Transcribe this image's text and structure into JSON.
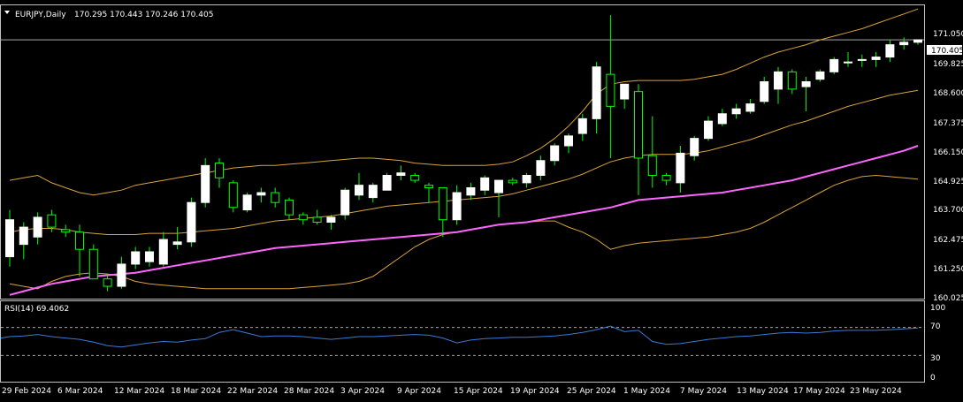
{
  "header": {
    "symbol": "EURJPY,Daily",
    "ohlc": "170.295 170.443 170.246 170.405"
  },
  "rsi_panel": {
    "label": "RSI(14) 69.4062",
    "levels": [
      "100",
      "70",
      "30",
      "0"
    ]
  },
  "price_axis": {
    "ticks": [
      "171.050",
      "169.825",
      "168.600",
      "167.375",
      "166.150",
      "164.925",
      "163.700",
      "162.475",
      "161.250",
      "160.025"
    ],
    "current_price": "170.405"
  },
  "time_axis": {
    "labels": [
      "29 Feb 2024",
      "6 Mar 2024",
      "12 Mar 2024",
      "18 Mar 2024",
      "22 Mar 2024",
      "28 Mar 2024",
      "3 Apr 2024",
      "9 Apr 2024",
      "15 Apr 2024",
      "19 Apr 2024",
      "25 Apr 2024",
      "1 May 2024",
      "7 May 2024",
      "13 May 2024",
      "17 May 2024",
      "23 May 2024"
    ]
  },
  "colors": {
    "background": "#000000",
    "bull_candle": "#ffffff",
    "bear_candle": "#000000",
    "wick": "#00ff00",
    "bollinger": "#d9a33a",
    "ma": "#ff66ff",
    "rsi_line": "#3a7bd5",
    "grid_level": "#c0c0c0",
    "axis": "#c0c0c0"
  },
  "chart_data": [
    {
      "type": "candlestick",
      "title": "EURJPY,Daily",
      "ylim": [
        159.9,
        171.8
      ],
      "indicators": [
        "Bollinger Bands",
        "Moving Average"
      ],
      "candles": [
        {
          "o": 161.6,
          "h": 163.5,
          "l": 161.2,
          "c": 163.1
        },
        {
          "o": 162.1,
          "h": 163.0,
          "l": 161.5,
          "c": 162.8
        },
        {
          "o": 162.4,
          "h": 163.4,
          "l": 162.1,
          "c": 163.2
        },
        {
          "o": 163.3,
          "h": 163.5,
          "l": 162.6,
          "c": 162.8
        },
        {
          "o": 162.7,
          "h": 162.9,
          "l": 162.4,
          "c": 162.6
        },
        {
          "o": 162.6,
          "h": 162.9,
          "l": 160.8,
          "c": 161.9
        },
        {
          "o": 161.9,
          "h": 162.1,
          "l": 160.7,
          "c": 160.7
        },
        {
          "o": 160.7,
          "h": 160.9,
          "l": 160.2,
          "c": 160.4
        },
        {
          "o": 160.4,
          "h": 161.6,
          "l": 160.3,
          "c": 161.3
        },
        {
          "o": 161.3,
          "h": 162.0,
          "l": 161.1,
          "c": 161.8
        },
        {
          "o": 161.4,
          "h": 162.0,
          "l": 161.2,
          "c": 161.8
        },
        {
          "o": 161.3,
          "h": 162.6,
          "l": 161.2,
          "c": 162.3
        },
        {
          "o": 162.1,
          "h": 162.8,
          "l": 161.9,
          "c": 162.2
        },
        {
          "o": 162.2,
          "h": 164.0,
          "l": 162.0,
          "c": 163.8
        },
        {
          "o": 163.8,
          "h": 165.6,
          "l": 163.6,
          "c": 165.3
        },
        {
          "o": 165.4,
          "h": 165.6,
          "l": 164.4,
          "c": 164.8
        },
        {
          "o": 164.6,
          "h": 164.7,
          "l": 163.4,
          "c": 163.6
        },
        {
          "o": 163.5,
          "h": 164.2,
          "l": 163.4,
          "c": 164.1
        },
        {
          "o": 164.1,
          "h": 164.4,
          "l": 163.8,
          "c": 164.2
        },
        {
          "o": 164.2,
          "h": 164.4,
          "l": 163.6,
          "c": 163.8
        },
        {
          "o": 163.9,
          "h": 164.0,
          "l": 163.1,
          "c": 163.3
        },
        {
          "o": 163.3,
          "h": 163.4,
          "l": 162.9,
          "c": 163.1
        },
        {
          "o": 163.2,
          "h": 163.5,
          "l": 162.9,
          "c": 163.0
        },
        {
          "o": 163.0,
          "h": 163.3,
          "l": 162.7,
          "c": 163.2
        },
        {
          "o": 163.3,
          "h": 164.4,
          "l": 163.1,
          "c": 164.3
        },
        {
          "o": 164.1,
          "h": 165.0,
          "l": 163.9,
          "c": 164.5
        },
        {
          "o": 164.0,
          "h": 164.6,
          "l": 163.8,
          "c": 164.5
        },
        {
          "o": 164.3,
          "h": 165.0,
          "l": 164.3,
          "c": 164.9
        },
        {
          "o": 164.9,
          "h": 165.3,
          "l": 164.7,
          "c": 165.0
        },
        {
          "o": 164.9,
          "h": 165.0,
          "l": 164.6,
          "c": 164.7
        },
        {
          "o": 164.5,
          "h": 164.6,
          "l": 163.8,
          "c": 164.4
        },
        {
          "o": 164.4,
          "h": 164.4,
          "l": 162.4,
          "c": 163.1
        },
        {
          "o": 163.1,
          "h": 164.5,
          "l": 162.9,
          "c": 164.2
        },
        {
          "o": 164.1,
          "h": 164.6,
          "l": 163.9,
          "c": 164.4
        },
        {
          "o": 164.3,
          "h": 164.9,
          "l": 164.1,
          "c": 164.8
        },
        {
          "o": 164.2,
          "h": 164.7,
          "l": 163.2,
          "c": 164.7
        },
        {
          "o": 164.7,
          "h": 164.8,
          "l": 164.5,
          "c": 164.6
        },
        {
          "o": 164.6,
          "h": 165.0,
          "l": 164.4,
          "c": 164.9
        },
        {
          "o": 164.9,
          "h": 165.7,
          "l": 164.7,
          "c": 165.5
        },
        {
          "o": 165.5,
          "h": 166.2,
          "l": 165.3,
          "c": 166.1
        },
        {
          "o": 166.1,
          "h": 166.6,
          "l": 165.8,
          "c": 166.5
        },
        {
          "o": 166.6,
          "h": 167.4,
          "l": 166.3,
          "c": 167.2
        },
        {
          "o": 167.2,
          "h": 169.5,
          "l": 166.6,
          "c": 169.3
        },
        {
          "o": 169.0,
          "h": 171.4,
          "l": 165.6,
          "c": 167.7
        },
        {
          "o": 168.0,
          "h": 168.6,
          "l": 167.6,
          "c": 168.6
        },
        {
          "o": 168.3,
          "h": 168.6,
          "l": 164.1,
          "c": 165.6
        },
        {
          "o": 165.7,
          "h": 167.3,
          "l": 164.4,
          "c": 164.9
        },
        {
          "o": 164.9,
          "h": 165.0,
          "l": 164.5,
          "c": 164.7
        },
        {
          "o": 164.6,
          "h": 166.1,
          "l": 164.2,
          "c": 165.8
        },
        {
          "o": 165.7,
          "h": 166.5,
          "l": 165.5,
          "c": 166.4
        },
        {
          "o": 166.4,
          "h": 167.3,
          "l": 166.3,
          "c": 167.1
        },
        {
          "o": 167.0,
          "h": 167.6,
          "l": 166.9,
          "c": 167.4
        },
        {
          "o": 167.4,
          "h": 167.8,
          "l": 167.2,
          "c": 167.6
        },
        {
          "o": 167.5,
          "h": 168.0,
          "l": 167.4,
          "c": 167.8
        },
        {
          "o": 167.9,
          "h": 168.9,
          "l": 167.8,
          "c": 168.7
        },
        {
          "o": 168.4,
          "h": 169.3,
          "l": 167.8,
          "c": 169.1
        },
        {
          "o": 169.1,
          "h": 169.2,
          "l": 168.2,
          "c": 168.4
        },
        {
          "o": 168.5,
          "h": 168.9,
          "l": 167.5,
          "c": 168.7
        },
        {
          "o": 168.8,
          "h": 169.2,
          "l": 168.7,
          "c": 169.1
        },
        {
          "o": 169.1,
          "h": 169.7,
          "l": 169.0,
          "c": 169.6
        },
        {
          "o": 169.5,
          "h": 169.9,
          "l": 169.3,
          "c": 169.5
        },
        {
          "o": 169.6,
          "h": 169.8,
          "l": 169.3,
          "c": 169.6
        },
        {
          "o": 169.6,
          "h": 169.9,
          "l": 169.3,
          "c": 169.7
        },
        {
          "o": 169.7,
          "h": 170.4,
          "l": 169.5,
          "c": 170.2
        },
        {
          "o": 170.2,
          "h": 170.5,
          "l": 170.0,
          "c": 170.3
        },
        {
          "o": 170.3,
          "h": 170.4,
          "l": 170.2,
          "c": 170.4
        }
      ],
      "bb_upper": [
        164.7,
        164.8,
        164.9,
        164.6,
        164.4,
        164.2,
        164.1,
        164.2,
        164.3,
        164.5,
        164.6,
        164.7,
        164.8,
        164.9,
        165.0,
        165.1,
        165.2,
        165.25,
        165.3,
        165.3,
        165.35,
        165.4,
        165.45,
        165.5,
        165.55,
        165.6,
        165.6,
        165.55,
        165.5,
        165.4,
        165.35,
        165.3,
        165.3,
        165.3,
        165.3,
        165.35,
        165.45,
        165.7,
        166.0,
        166.4,
        166.9,
        167.5,
        168.2,
        168.6,
        168.7,
        168.75,
        168.75,
        168.75,
        168.75,
        168.8,
        168.9,
        169.0,
        169.2,
        169.45,
        169.7,
        169.9,
        170.05,
        170.2,
        170.4,
        170.55,
        170.7,
        170.85,
        171.05,
        171.25,
        171.45,
        171.65
      ],
      "bb_middle": [
        162.6,
        162.7,
        162.75,
        162.75,
        162.7,
        162.6,
        162.55,
        162.5,
        162.5,
        162.5,
        162.55,
        162.55,
        162.55,
        162.6,
        162.65,
        162.7,
        162.75,
        162.85,
        162.95,
        163.05,
        163.1,
        163.15,
        163.2,
        163.25,
        163.35,
        163.45,
        163.55,
        163.65,
        163.7,
        163.75,
        163.8,
        163.85,
        163.9,
        163.95,
        164.0,
        164.05,
        164.15,
        164.3,
        164.45,
        164.6,
        164.75,
        164.95,
        165.2,
        165.45,
        165.6,
        165.7,
        165.75,
        165.75,
        165.75,
        165.8,
        165.9,
        166.05,
        166.2,
        166.35,
        166.55,
        166.75,
        166.95,
        167.1,
        167.3,
        167.5,
        167.7,
        167.85,
        168.0,
        168.15,
        168.25,
        168.35
      ],
      "bb_lower": [
        160.5,
        160.4,
        160.3,
        160.6,
        160.8,
        160.9,
        160.95,
        160.9,
        160.8,
        160.6,
        160.5,
        160.45,
        160.4,
        160.35,
        160.3,
        160.3,
        160.3,
        160.3,
        160.3,
        160.3,
        160.3,
        160.35,
        160.4,
        160.45,
        160.5,
        160.6,
        160.8,
        161.2,
        161.6,
        162.0,
        162.3,
        162.5,
        162.6,
        162.7,
        162.8,
        162.9,
        162.95,
        163.0,
        163.05,
        163.05,
        162.8,
        162.6,
        162.3,
        161.9,
        162.05,
        162.15,
        162.2,
        162.25,
        162.3,
        162.35,
        162.4,
        162.5,
        162.6,
        162.75,
        163.0,
        163.3,
        163.6,
        163.9,
        164.2,
        164.5,
        164.7,
        164.85,
        164.9,
        164.85,
        164.8,
        164.75
      ],
      "ma": [
        160.05,
        160.2,
        160.35,
        160.5,
        160.6,
        160.7,
        160.8,
        160.85,
        160.9,
        160.95,
        161.05,
        161.15,
        161.25,
        161.35,
        161.45,
        161.55,
        161.65,
        161.75,
        161.85,
        161.95,
        162.0,
        162.05,
        162.1,
        162.15,
        162.2,
        162.25,
        162.3,
        162.35,
        162.4,
        162.45,
        162.5,
        162.55,
        162.6,
        162.7,
        162.8,
        162.9,
        162.95,
        163.0,
        163.1,
        163.2,
        163.3,
        163.4,
        163.5,
        163.6,
        163.75,
        163.9,
        163.95,
        164.0,
        164.05,
        164.1,
        164.15,
        164.2,
        164.3,
        164.4,
        164.5,
        164.6,
        164.7,
        164.85,
        165.0,
        165.15,
        165.3,
        165.45,
        165.6,
        165.75,
        165.9,
        166.1
      ]
    },
    {
      "type": "line",
      "title": "RSI(14) 69.4062",
      "ylim": [
        0,
        100
      ],
      "levels": [
        70,
        30
      ],
      "values": [
        57,
        58,
        60,
        57,
        55,
        53,
        49,
        44,
        42,
        45,
        48,
        50,
        49,
        52,
        54,
        63,
        67,
        62,
        57,
        58,
        58,
        57,
        55,
        53,
        55,
        57,
        57,
        58,
        59,
        60,
        59,
        55,
        48,
        52,
        54,
        55,
        56,
        56,
        57,
        58,
        60,
        63,
        67,
        72,
        64,
        66,
        50,
        46,
        47,
        50,
        53,
        55,
        57,
        58,
        60,
        62,
        63,
        62,
        63,
        65,
        66,
        66,
        66,
        67,
        68,
        69.4
      ]
    }
  ]
}
